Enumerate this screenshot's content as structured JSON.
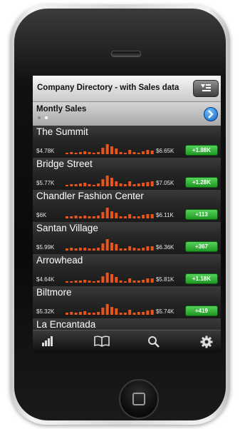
{
  "app": {
    "title": "Company Directory - with Sales data"
  },
  "section": {
    "title": "Montly Sales",
    "page_dots": 2,
    "active_dot": 1
  },
  "rows": [
    {
      "name": "The Summit",
      "min": "$4.78K",
      "max": "$6.65K",
      "change": "+1.88K"
    },
    {
      "name": "Bridge Street",
      "min": "$5.77K",
      "max": "$7.05K",
      "change": "+1.28K"
    },
    {
      "name": "Chandler Fashion Center",
      "min": "$6K",
      "max": "$6.11K",
      "change": "+113"
    },
    {
      "name": "Santan Village",
      "min": "$5.99K",
      "max": "$6.36K",
      "change": "+367"
    },
    {
      "name": "Arrowhead",
      "min": "$4.64K",
      "max": "$5.81K",
      "change": "+1.18K"
    },
    {
      "name": "Biltmore",
      "min": "$5.32K",
      "max": "$5.74K",
      "change": "+419"
    },
    {
      "name": "La Encantada",
      "min": "",
      "max": "",
      "change": ""
    }
  ],
  "tabs": [
    {
      "icon": "bar-chart-icon"
    },
    {
      "icon": "book-icon"
    },
    {
      "icon": "search-icon"
    },
    {
      "icon": "gear-icon"
    }
  ],
  "colors": {
    "sparkline": "#e8541b",
    "badge": "#2fb334",
    "disclosure": "#1a73d6"
  }
}
